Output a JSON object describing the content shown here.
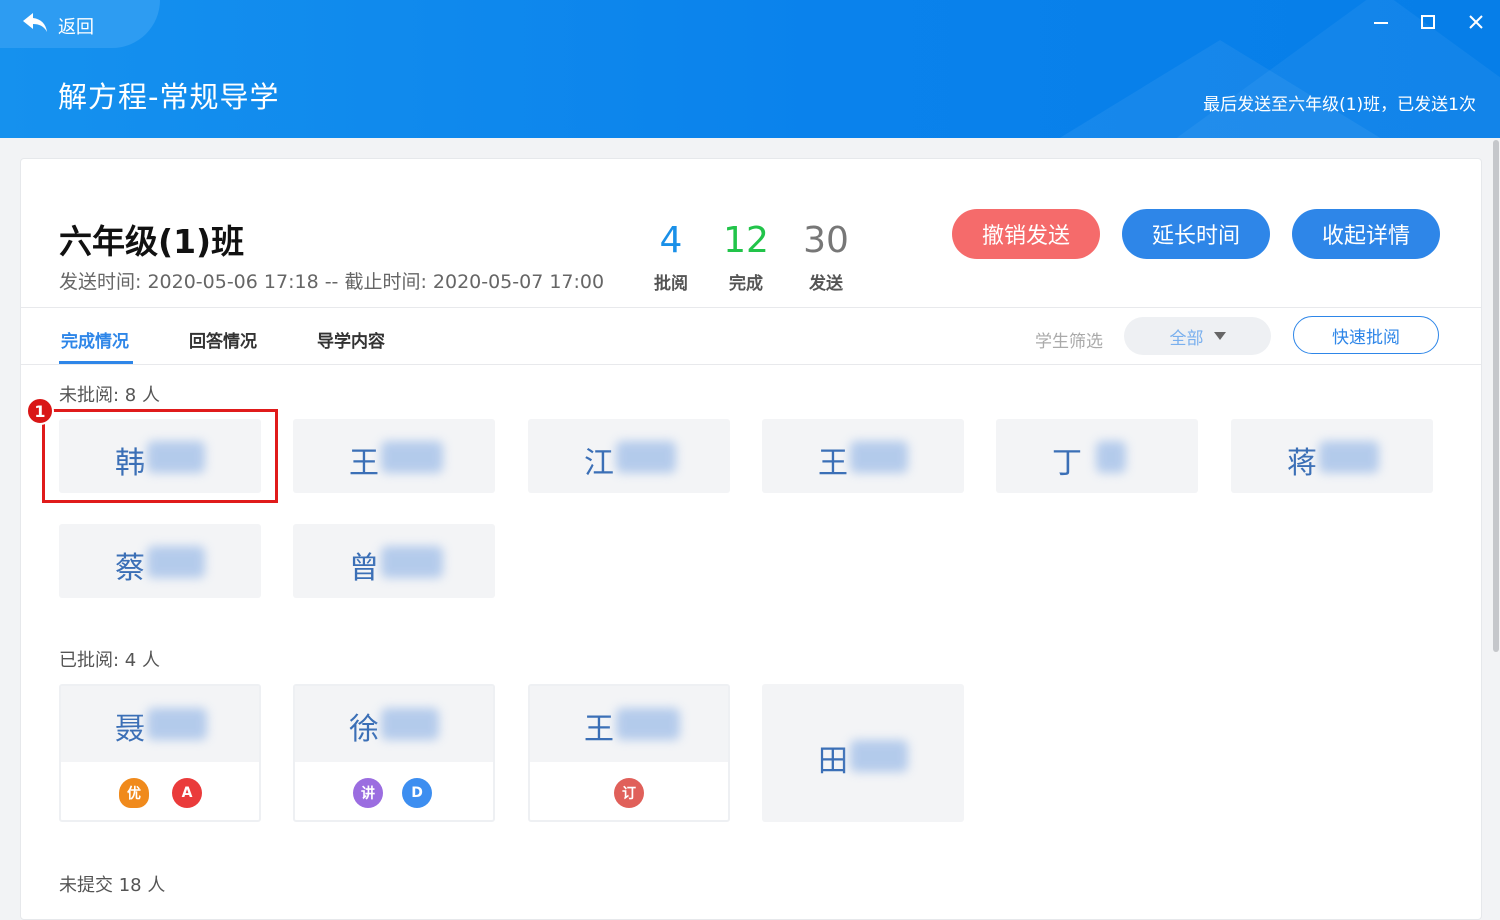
{
  "header": {
    "back_label": "返回",
    "title": "解方程-常规导学",
    "last_sent": "最后发送至六年级(1)班，已发送1次"
  },
  "class_info": {
    "name": "六年级(1)班",
    "send_time": "发送时间: 2020-05-06 17:18 -- 截止时间: 2020-05-07 17:00"
  },
  "stats": [
    {
      "value": "4",
      "label": "批阅",
      "color": "#1a90e8"
    },
    {
      "value": "12",
      "label": "完成",
      "color": "#22c44a"
    },
    {
      "value": "30",
      "label": "发送",
      "color": "#777777"
    }
  ],
  "actions": {
    "cancel_send": "撤销发送",
    "extend_time": "延长时间",
    "collapse_details": "收起详情"
  },
  "tabs": [
    {
      "label": "完成情况",
      "active": true
    },
    {
      "label": "回答情况",
      "active": false
    },
    {
      "label": "导学内容",
      "active": false
    }
  ],
  "filter": {
    "label": "学生筛选",
    "selected": "全部",
    "quick_review": "快速批阅"
  },
  "sections": {
    "unreviewed_title": "未批阅: 8 人",
    "reviewed_title": "已批阅: 4 人",
    "unsubmitted_title": "未提交 18 人"
  },
  "unreviewed_students": [
    "韩",
    "王",
    "江",
    "王",
    "丁",
    "蒋",
    "蔡",
    "曾"
  ],
  "reviewed_students": [
    {
      "name": "聂",
      "badges": [
        {
          "text": "优",
          "color": "#f08a1c"
        },
        {
          "text": "A",
          "color": "#ea3b3b"
        }
      ]
    },
    {
      "name": "徐",
      "badges": [
        {
          "text": "讲",
          "color": "#9b6de0"
        },
        {
          "text": "D",
          "color": "#3d8ef0"
        }
      ]
    },
    {
      "name": "王",
      "badges": [
        {
          "text": "订",
          "color": "#e0605a"
        }
      ]
    },
    {
      "name": "田",
      "badges": []
    }
  ],
  "annotation": {
    "marker": "1"
  },
  "colors": {
    "header_bg": "#0a82ec",
    "accent": "#2e86e8",
    "cancel_btn": "#f56b6b",
    "highlight": "#e01b1b"
  }
}
